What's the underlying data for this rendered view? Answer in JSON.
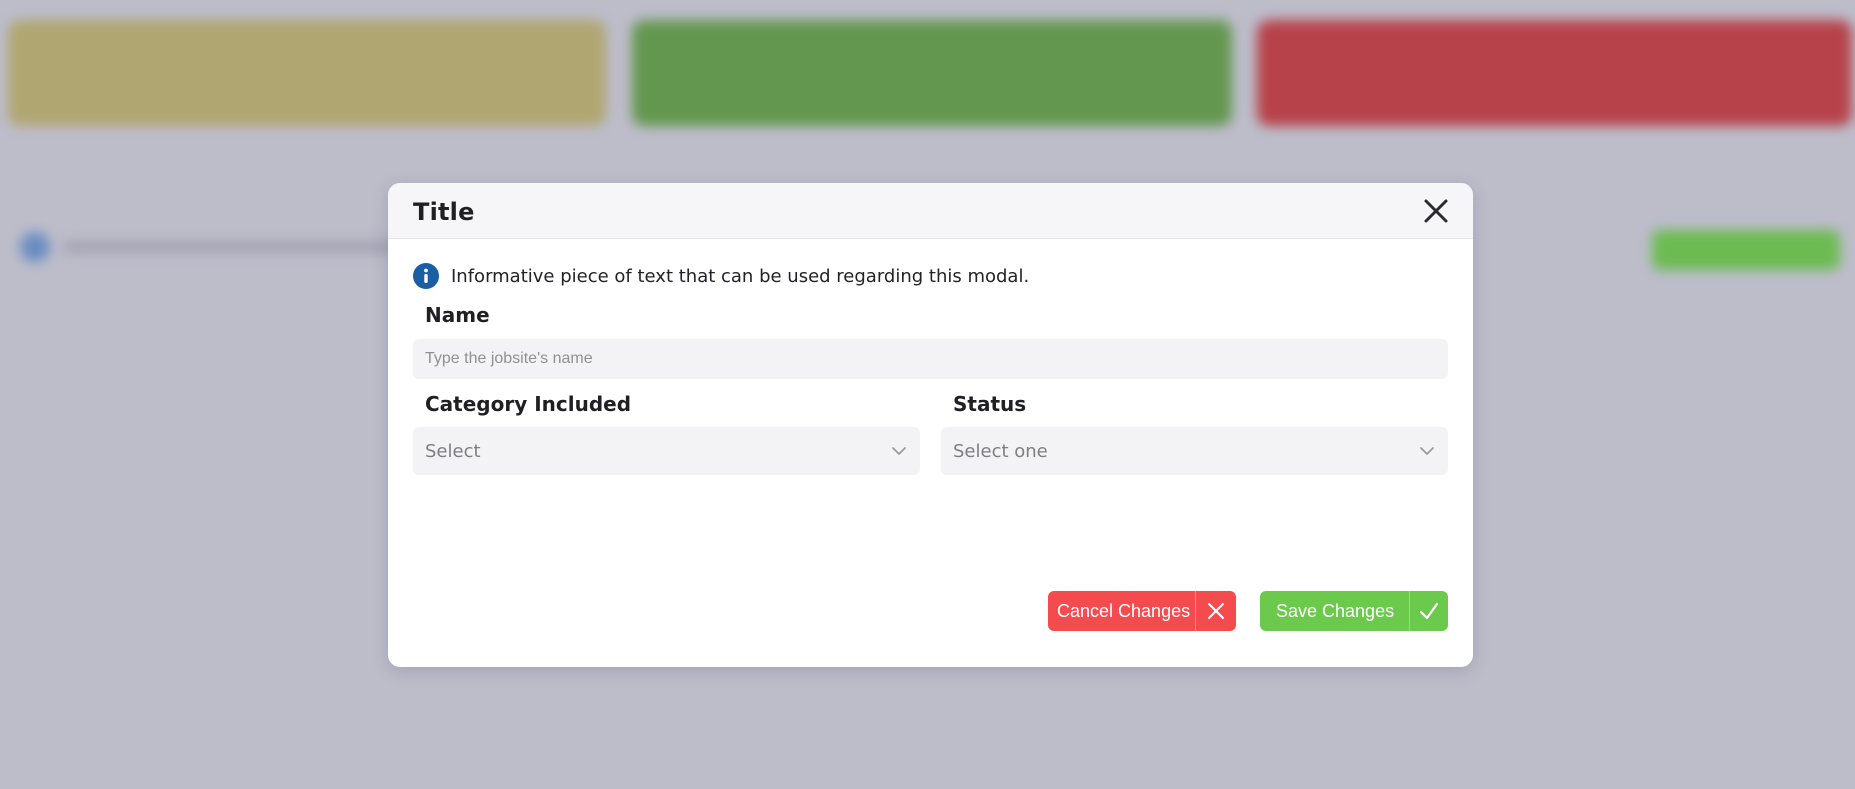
{
  "modal": {
    "title": "Title",
    "info_text": "Informative piece of text that can be used regarding this modal.",
    "name_field": {
      "label": "Name",
      "value": "",
      "placeholder": "Type the jobsite's name"
    },
    "category_field": {
      "label": "Category Included",
      "selected": "Select"
    },
    "status_field": {
      "label": "Status",
      "selected": "Select one"
    },
    "cancel_button": {
      "label": "Cancel Changes",
      "icon": "close-icon"
    },
    "save_button": {
      "label": "Save Changes",
      "icon": "check-icon"
    }
  },
  "colors": {
    "cancel": "#f44c4e",
    "save": "#6bc94b",
    "info": "#1a5ea3",
    "backdrop": "#bdbdca"
  }
}
